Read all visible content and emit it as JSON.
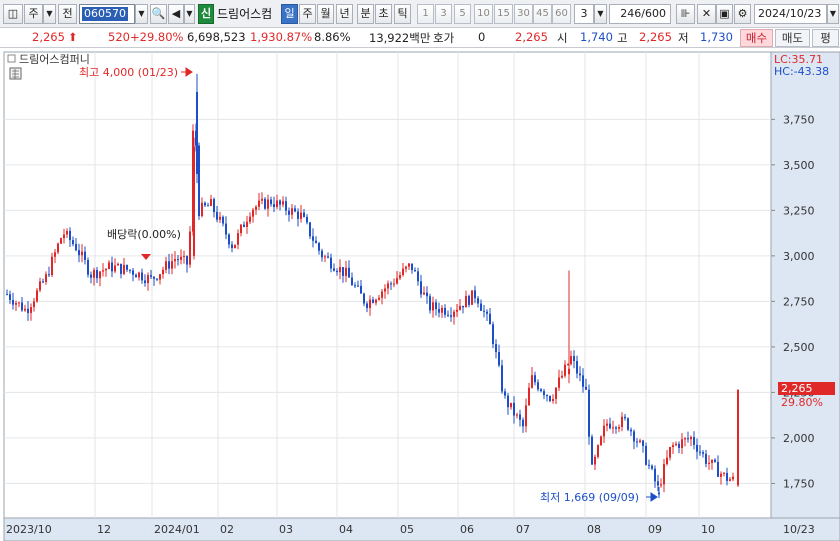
{
  "toolbar": {
    "type_label": "주",
    "prev_label": "전",
    "code": "060570",
    "badge": "신",
    "stock_name": "드림어스컴",
    "periods": [
      "일",
      "주",
      "월",
      "년",
      "분",
      "초",
      "틱"
    ],
    "active_period": "일",
    "numbers": [
      "1",
      "3",
      "5",
      "10",
      "15",
      "30",
      "45",
      "60"
    ],
    "dropdown_value": "3",
    "count": "246/600",
    "date": "2024/10/23"
  },
  "quote": {
    "price": "2,265",
    "change": "520",
    "change_rate": "+29.80%",
    "volume": "6,698,523",
    "volume_rate": "1,930.87%",
    "turnover": "8.86%",
    "amount": "13,922백만",
    "ask_label": "호가",
    "ask_value": "0",
    "ask_price": "2,265",
    "open_label": "시",
    "open": "1,740",
    "high_label": "고",
    "high": "2,265",
    "low_label": "저",
    "low": "1,730",
    "buy_label": "매수",
    "sell_label": "매도",
    "eval_label": "평"
  },
  "chart": {
    "legend_name": "드림어스컴퍼니",
    "lc": "LC:35.71",
    "hc": "HC:-43.38",
    "high_annotation": "최고 4,000 (01/23)",
    "low_annotation": "최저 1,669 (09/09)",
    "dividend_annotation": "배당락(0.00%)",
    "current_price_tag": "2,265",
    "current_rate_tag": "29.80%",
    "colors": {
      "up": "#e12828",
      "down": "#1c4fc7",
      "price_tag": "#e12828"
    }
  },
  "chart_data": {
    "type": "candlestick",
    "title": "",
    "y_ticks": [
      1750,
      2000,
      2250,
      2500,
      2750,
      3000,
      3250,
      3500,
      3750
    ],
    "y_tick_labels": [
      "1,750",
      "2,000",
      "2,250",
      "2,500",
      "2,750",
      "3,000",
      "3,250",
      "3,500",
      "3,750"
    ],
    "ylim": [
      1560,
      4120
    ],
    "x_labels": [
      "2023/10",
      "12",
      "2024/01",
      "02",
      "03",
      "04",
      "05",
      "06",
      "07",
      "08",
      "09",
      "10",
      "10/23"
    ],
    "grid": true,
    "series": [
      {
        "x": "2023/10",
        "close": 2800
      },
      {
        "x": "2023/11",
        "close": 3120
      },
      {
        "x": "2023/12",
        "close": 2900
      },
      {
        "x": "2024/01",
        "close": 2980
      },
      {
        "x": "2024/01/23",
        "close": 3900,
        "high": 4000
      },
      {
        "x": "2024/02",
        "close": 3250
      },
      {
        "x": "2024/03",
        "close": 3280
      },
      {
        "x": "2024/04",
        "close": 2780
      },
      {
        "x": "2024/05",
        "close": 2950
      },
      {
        "x": "2024/06",
        "close": 2720
      },
      {
        "x": "2024/07",
        "close": 2100
      },
      {
        "x": "2024/08",
        "close": 2450
      },
      {
        "x": "2024/09/09",
        "close": 1700,
        "low": 1669
      },
      {
        "x": "2024/10",
        "close": 1800
      },
      {
        "x": "2024/10/23",
        "open": 1740,
        "high": 2265,
        "low": 1730,
        "close": 2265
      }
    ]
  }
}
